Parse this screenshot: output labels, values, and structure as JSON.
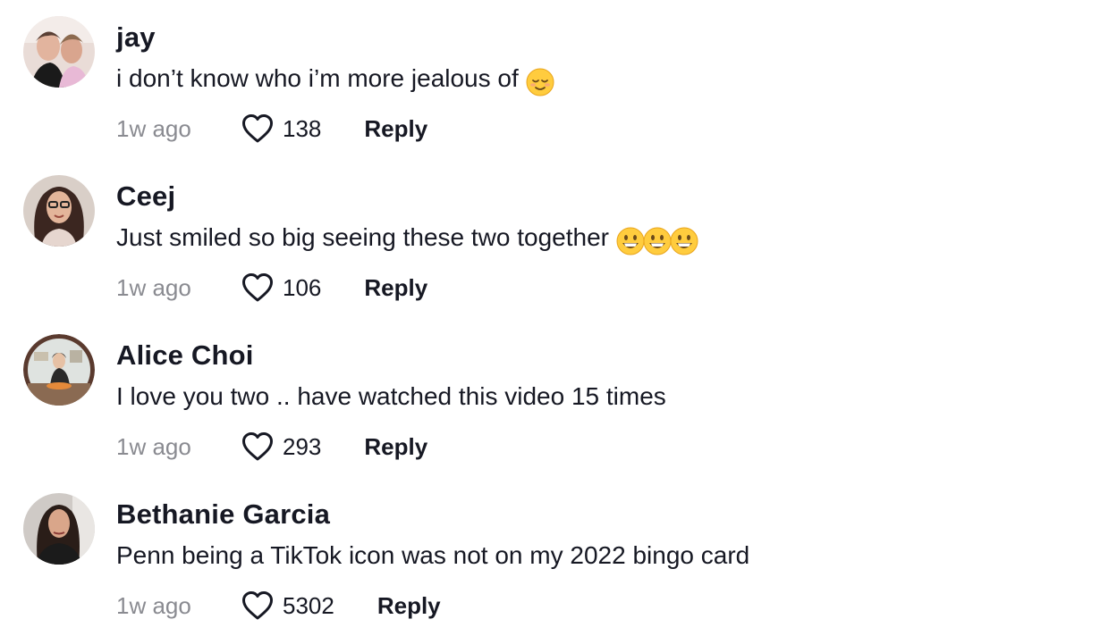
{
  "comments": [
    {
      "username": "jay",
      "text": "i don’t know who i’m more jealous of",
      "emoji": "relieved-face",
      "time": "1w ago",
      "likes": "138",
      "reply_label": "Reply"
    },
    {
      "username": "Ceej",
      "text": "Just smiled so big seeing these two together",
      "emoji": "grinning-face x3",
      "time": "1w ago",
      "likes": "106",
      "reply_label": "Reply"
    },
    {
      "username": "Alice Choi",
      "text": "I love you two .. have watched this video 15 times",
      "time": "1w ago",
      "likes": "293",
      "reply_label": "Reply"
    },
    {
      "username": "Bethanie Garcia",
      "text": "Penn being a TikTok icon was not on my 2022 bingo card",
      "time": "1w ago",
      "likes": "5302",
      "reply_label": "Reply"
    }
  ],
  "icons": {
    "like": "heart-outline-icon",
    "emoji_1": "relieved-face-emoji",
    "emoji_2": "grinning-face-emoji"
  },
  "colors": {
    "text_primary": "#161823",
    "text_secondary": "#8a8b91",
    "background": "#ffffff"
  }
}
